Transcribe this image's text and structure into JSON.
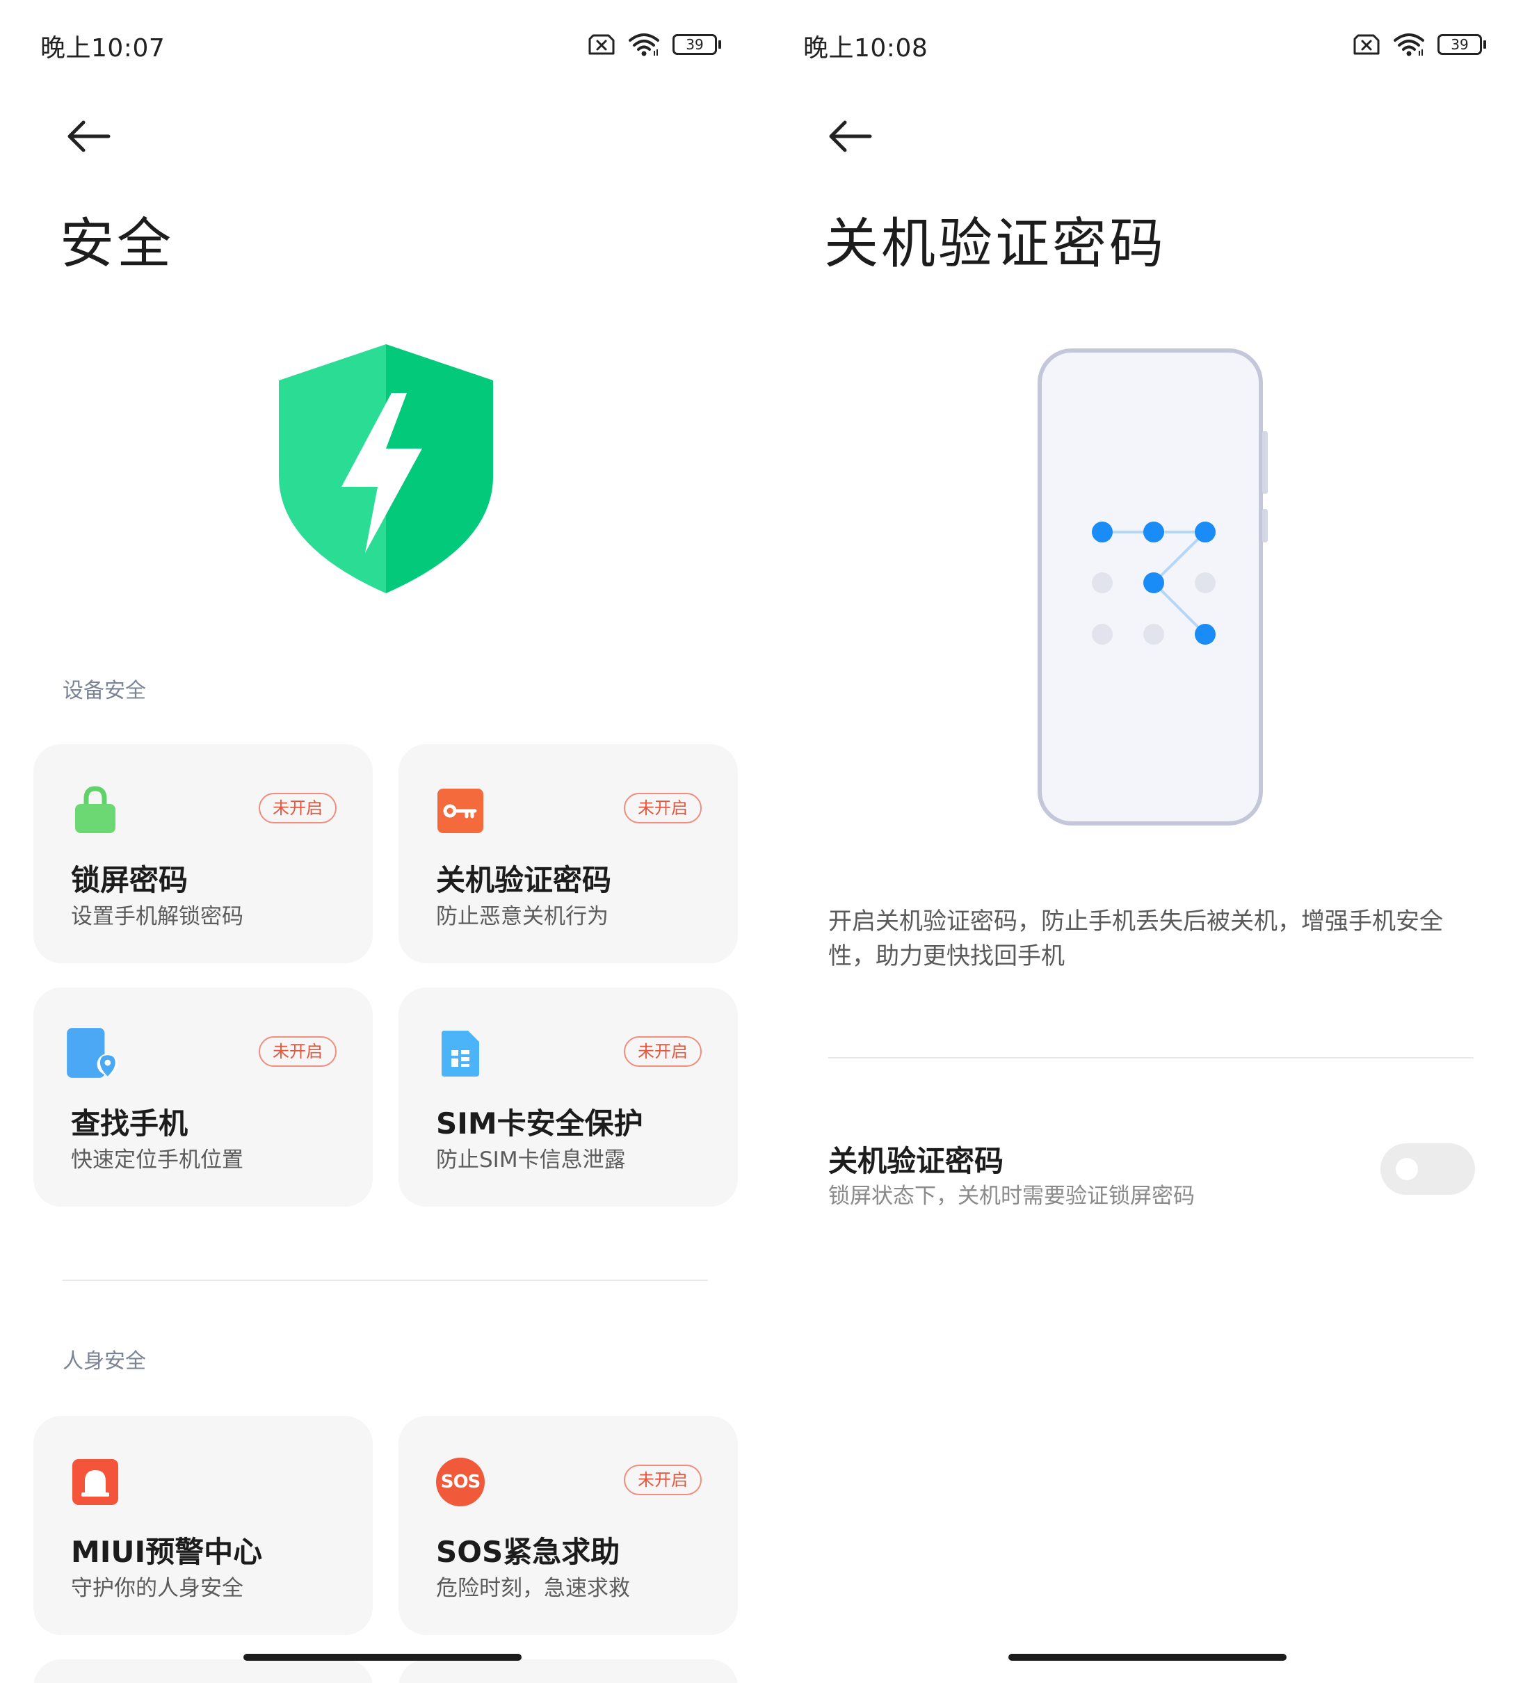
{
  "left": {
    "status_time": "晚上10:07",
    "battery": "39",
    "title": "安全",
    "sections": [
      {
        "label": "设备安全"
      },
      {
        "label": "人身安全"
      }
    ],
    "cards": [
      {
        "title": "锁屏密码",
        "sub": "设置手机解锁密码",
        "badge": "未开启",
        "icon": "lock-icon"
      },
      {
        "title": "关机验证密码",
        "sub": "防止恶意关机行为",
        "badge": "未开启",
        "icon": "key-icon"
      },
      {
        "title": "查找手机",
        "sub": "快速定位手机位置",
        "badge": "未开启",
        "icon": "find-phone-icon"
      },
      {
        "title": "SIM卡安全保护",
        "sub": "防止SIM卡信息泄露",
        "badge": "未开启",
        "icon": "sim-card-icon"
      },
      {
        "title": "MIUI预警中心",
        "sub": "守护你的人身安全",
        "badge": "",
        "icon": "alarm-icon"
      },
      {
        "title": "SOS紧急求助",
        "sub": "危险时刻，急速求救",
        "badge": "未开启",
        "icon": "sos-icon",
        "icon_text": "SOS"
      }
    ]
  },
  "right": {
    "status_time": "晚上10:08",
    "battery": "39",
    "title": "关机验证密码",
    "description": "开启关机验证密码，防止手机丢失后被关机，增强手机安全性，助力更快找回手机",
    "setting": {
      "title": "关机验证密码",
      "sub": "锁屏状态下，关机时需要验证锁屏密码",
      "enabled": false
    }
  },
  "colors": {
    "shield_green": "#22d38a",
    "badge_red": "#e5573f",
    "pattern_blue": "#1a8cf7",
    "card_bg": "#f6f6f6"
  }
}
